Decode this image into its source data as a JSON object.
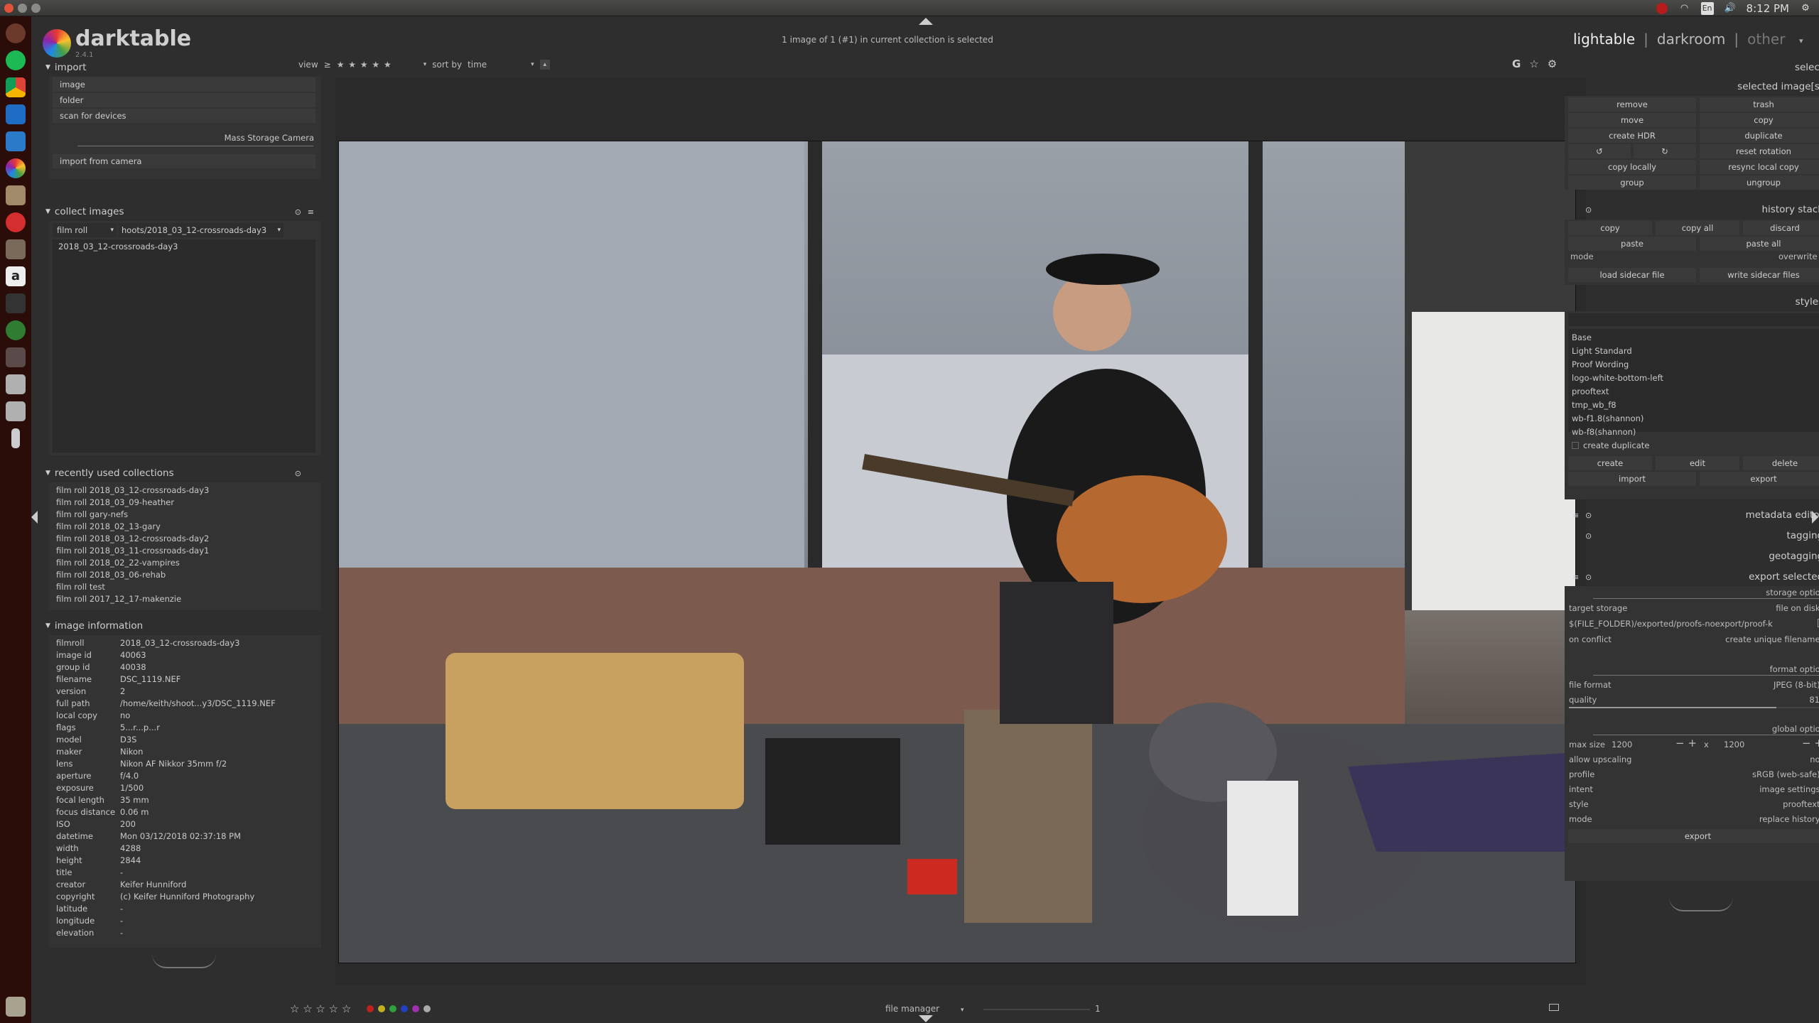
{
  "system": {
    "keyboard_layout": "En",
    "clock": "8:12 PM"
  },
  "app": {
    "name": "darktable",
    "version": "2.4.1",
    "selection_status": "1 image of 1 (#1) in current collection is selected",
    "views": [
      "lightable",
      "darkroom",
      "other"
    ],
    "separator": "|"
  },
  "toolbar": {
    "view_label": "view",
    "view_op": "≥",
    "stars": "★ ★ ★ ★ ★",
    "sort_label": "sort by",
    "sort_value": "time",
    "g_label": "G"
  },
  "import": {
    "header": "import",
    "items": [
      "image",
      "folder",
      "scan for devices"
    ],
    "camera_label": "Mass Storage Camera",
    "import_from_camera": "import from camera"
  },
  "collect": {
    "header": "collect images",
    "rule": "film roll",
    "path": "hoots/2018_03_12-crossroads-day3",
    "selected": "2018_03_12-crossroads-day3"
  },
  "recent": {
    "header": "recently used collections",
    "items": [
      "film roll 2018_03_12-crossroads-day3",
      "film roll 2018_03_09-heather",
      "film roll gary-nefs",
      "film roll 2018_02_13-gary",
      "film roll 2018_03_12-crossroads-day2",
      "film roll 2018_03_11-crossroads-day1",
      "film roll 2018_02_22-vampires",
      "film roll 2018_03_06-rehab",
      "film roll test",
      "film roll 2017_12_17-makenzie"
    ]
  },
  "info": {
    "header": "image information",
    "rows": [
      {
        "k": "filmroll",
        "v": "2018_03_12-crossroads-day3"
      },
      {
        "k": "image id",
        "v": "40063"
      },
      {
        "k": "group id",
        "v": "40038"
      },
      {
        "k": "filename",
        "v": "DSC_1119.NEF"
      },
      {
        "k": "version",
        "v": "2"
      },
      {
        "k": "full path",
        "v": "/home/keith/shoot...y3/DSC_1119.NEF"
      },
      {
        "k": "local copy",
        "v": "no"
      },
      {
        "k": "flags",
        "v": "5...r...p...r"
      },
      {
        "k": "model",
        "v": "D3S"
      },
      {
        "k": "maker",
        "v": "Nikon"
      },
      {
        "k": "lens",
        "v": "Nikon AF Nikkor 35mm f/2"
      },
      {
        "k": "aperture",
        "v": "f/4.0"
      },
      {
        "k": "exposure",
        "v": "1/500"
      },
      {
        "k": "focal length",
        "v": "35 mm"
      },
      {
        "k": "focus distance",
        "v": "0.06 m"
      },
      {
        "k": "ISO",
        "v": "200"
      },
      {
        "k": "datetime",
        "v": "Mon 03/12/2018 02:37:18 PM"
      },
      {
        "k": "width",
        "v": "4288"
      },
      {
        "k": "height",
        "v": "2844"
      },
      {
        "k": "title",
        "v": "-"
      },
      {
        "k": "creator",
        "v": "Keifer Hunniford"
      },
      {
        "k": "copyright",
        "v": "(c) Keifer Hunniford Photography"
      },
      {
        "k": "latitude",
        "v": "-"
      },
      {
        "k": "longitude",
        "v": "-"
      },
      {
        "k": "elevation",
        "v": "-"
      }
    ]
  },
  "right": {
    "select": "select",
    "selected_images": "selected image[s]",
    "sel_buttons": [
      "remove",
      "trash",
      "move",
      "copy",
      "create HDR",
      "duplicate",
      "↺",
      "↻",
      "reset rotation",
      "copy locally",
      "resync local copy",
      "group",
      "ungroup"
    ],
    "history_stack": "history stack",
    "hist_buttons": [
      "copy",
      "copy all",
      "discard",
      "paste",
      "paste all"
    ],
    "mode_label": "mode",
    "mode_value": "overwrite",
    "load_sidecar": "load sidecar file",
    "write_sidecar": "write sidecar files",
    "styles": "styles",
    "style_items": [
      "Base",
      "Light Standard",
      "Proof Wording",
      "logo-white-bottom-left",
      "prooftext",
      "tmp_wb_f8",
      "wb-f1.8(shannon)",
      "wb-f8(shannon)"
    ],
    "create_duplicate": "create duplicate",
    "style_buttons": [
      "create",
      "edit",
      "delete",
      "import",
      "export"
    ],
    "metadata_editor": "metadata editor",
    "tagging": "tagging",
    "geotagging": "geotagging",
    "export_selected": "export selected",
    "storage_options": "storage options",
    "target_storage_label": "target storage",
    "target_storage_value": "file on disk",
    "path_value": "$(FILE_FOLDER)/exported/proofs-noexport/proof-k",
    "on_conflict_label": "on conflict",
    "on_conflict_value": "create unique filename",
    "format_options": "format options",
    "file_format_label": "file format",
    "file_format_value": "JPEG (8-bit)",
    "quality_label": "quality",
    "quality_value": "81",
    "quality_fraction": 0.81,
    "global_options": "global options",
    "max_size_label": "max size",
    "max_w": "1200",
    "max_h": "1200",
    "x_sep": "x",
    "upscaling_label": "allow upscaling",
    "upscaling_value": "no",
    "profile_label": "profile",
    "profile_value": "sRGB (web-safe)",
    "intent_label": "intent",
    "intent_value": "image settings",
    "style_label": "style",
    "style_value": "prooftext",
    "mode2_label": "mode",
    "mode2_value": "replace history",
    "export_button": "export"
  },
  "bottom": {
    "stars": "☆ ☆ ☆ ☆ ☆",
    "layout_mode": "file manager",
    "zoom_count": "1"
  },
  "colors": {
    "accent_red": "#cc3b2a",
    "label_red": "#c02020",
    "label_yellow": "#c0b020",
    "label_green": "#30a040",
    "label_blue": "#2040c0",
    "label_purple": "#a030b0"
  }
}
